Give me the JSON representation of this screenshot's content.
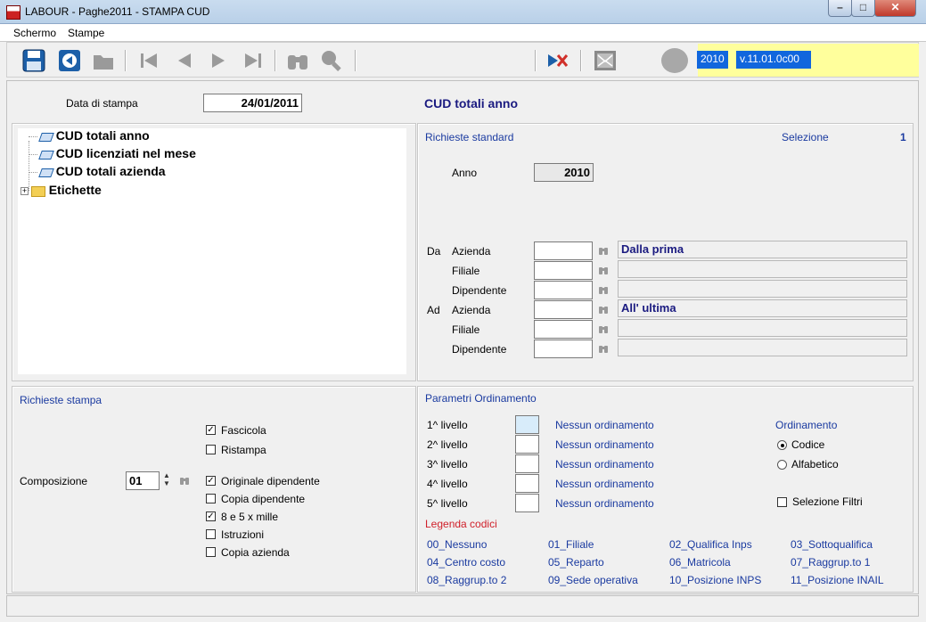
{
  "window": {
    "title": "LABOUR - Paghe2011 - STAMPA CUD"
  },
  "menu": {
    "items": [
      {
        "label": "Schermo"
      },
      {
        "label": "Stampe"
      }
    ]
  },
  "toolbar": {
    "year": "2010",
    "version": "v.11.01.0c00"
  },
  "header": {
    "date_label": "Data di stampa",
    "date_value": "24/01/2011",
    "report_title": "CUD totali anno"
  },
  "tree": {
    "items": [
      {
        "label": "CUD totali anno"
      },
      {
        "label": "CUD licenziati nel mese"
      },
      {
        "label": "CUD totali azienda"
      },
      {
        "label": "Etichette"
      }
    ]
  },
  "standard": {
    "title": "Richieste standard",
    "selection_label": "Selezione",
    "selection_value": "1",
    "year_label": "Anno",
    "year_value": "2010",
    "da_label": "Da",
    "ad_label": "Ad",
    "azienda_label": "Azienda",
    "filiale_label": "Filiale",
    "dipendente_label": "Dipendente",
    "from_desc": "Dalla prima",
    "to_desc": "All' ultima"
  },
  "print": {
    "title": "Richieste stampa",
    "fascicola": "Fascicola",
    "ristampa": "Ristampa",
    "composizione_label": "Composizione",
    "composizione_value": "01",
    "originale": "Originale dipendente",
    "copia_dip": "Copia dipendente",
    "ottoecinque": "8 e 5 x mille",
    "istruzioni": "Istruzioni",
    "copia_az": "Copia azienda"
  },
  "ordering": {
    "title": "Parametri Ordinamento",
    "levels": [
      {
        "label": "1^ livello",
        "desc": "Nessun ordinamento"
      },
      {
        "label": "2^ livello",
        "desc": "Nessun ordinamento"
      },
      {
        "label": "3^ livello",
        "desc": "Nessun ordinamento"
      },
      {
        "label": "4^ livello",
        "desc": "Nessun ordinamento"
      },
      {
        "label": "5^ livello",
        "desc": "Nessun ordinamento"
      }
    ],
    "ord_label": "Ordinamento",
    "codice": "Codice",
    "alfabetico": "Alfabetico",
    "filtri": "Selezione Filtri",
    "legend_title": "Legenda codici",
    "legend": [
      "00_Nessuno",
      "01_Filiale",
      "02_Qualifica Inps",
      "03_Sottoqualifica",
      "04_Centro costo",
      "05_Reparto",
      "06_Matricola",
      "07_Raggrup.to 1",
      "08_Raggrup.to 2",
      "09_Sede operativa",
      "10_Posizione INPS",
      "11_Posizione INAIL"
    ]
  }
}
